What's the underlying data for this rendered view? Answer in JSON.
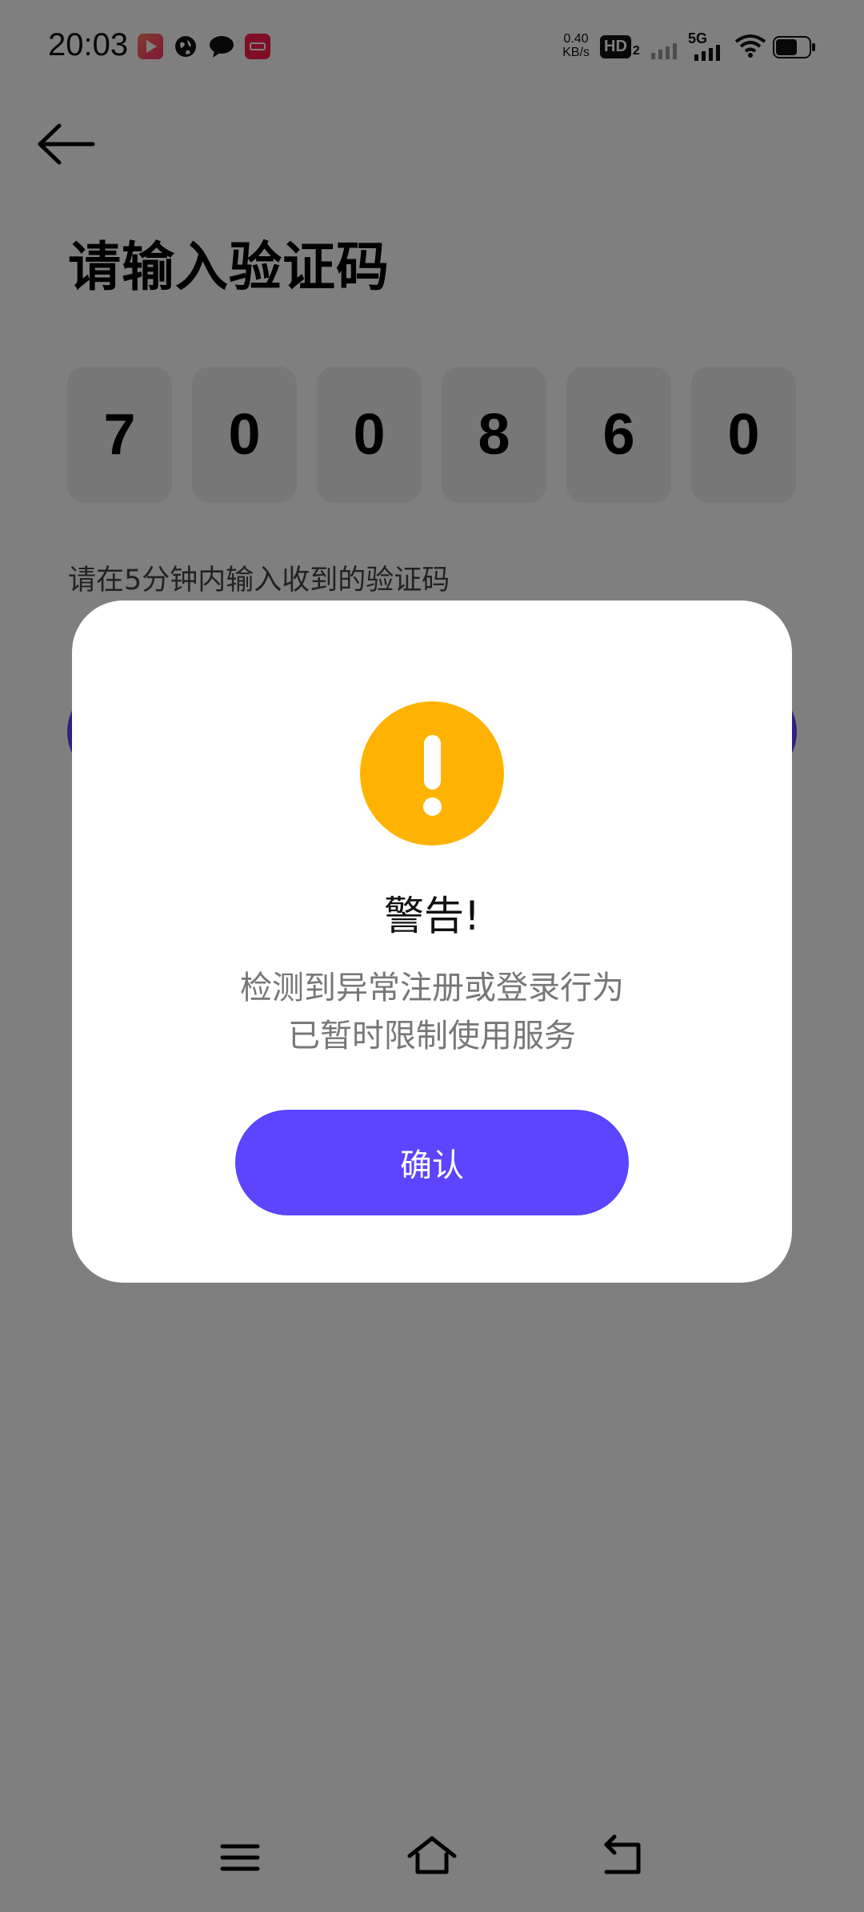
{
  "status_bar": {
    "time": "20:03",
    "net_speed_value": "0.40",
    "net_speed_unit": "KB/s",
    "hd_label": "HD",
    "hd_sub": "2",
    "network_label": "5G",
    "icons": [
      "video-app-icon",
      "globe-icon",
      "chat-icon",
      "shopping-app-icon",
      "signal-icon",
      "wifi-icon",
      "battery-icon"
    ]
  },
  "page": {
    "title": "请输入验证码",
    "code_digits": [
      "7",
      "0",
      "0",
      "8",
      "6",
      "0"
    ],
    "hint": "请在5分钟内输入收到的验证码",
    "accent_color": "#5b45ff"
  },
  "dialog": {
    "title": "警告!",
    "message_lines": [
      "检测到异常注册或登录行为",
      "已暂时限制使用服务"
    ],
    "confirm_label": "确认",
    "warning_color": "#ffb300",
    "icon": "warning-icon"
  },
  "nav_bar": {
    "icons": [
      "menu-icon",
      "home-icon",
      "back-icon"
    ]
  }
}
